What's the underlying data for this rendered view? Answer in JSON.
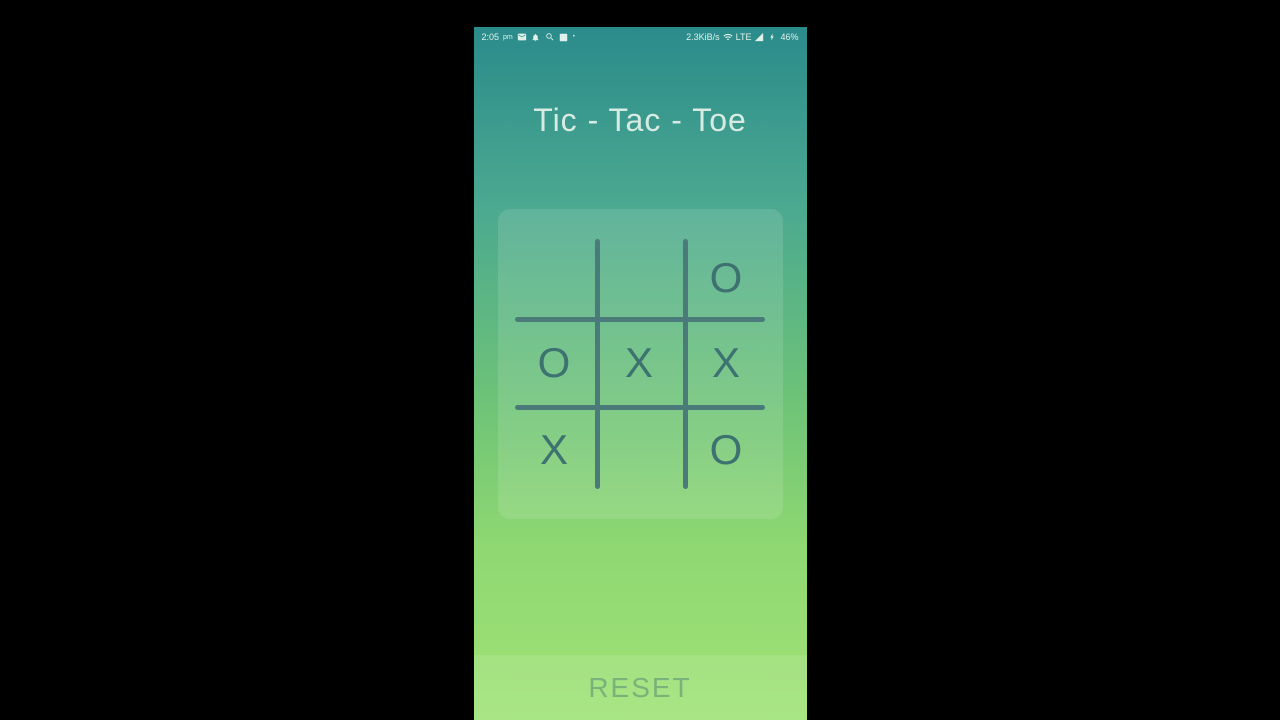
{
  "status_bar": {
    "time": "2:05",
    "time_period": "pm",
    "data_rate": "2.3KiB/s",
    "network": "LTE",
    "battery": "46%"
  },
  "game": {
    "title": "Tic - Tac - Toe",
    "board": [
      "",
      "",
      "O",
      "O",
      "X",
      "X",
      "X",
      "",
      "O"
    ],
    "reset_label": "RESET"
  }
}
